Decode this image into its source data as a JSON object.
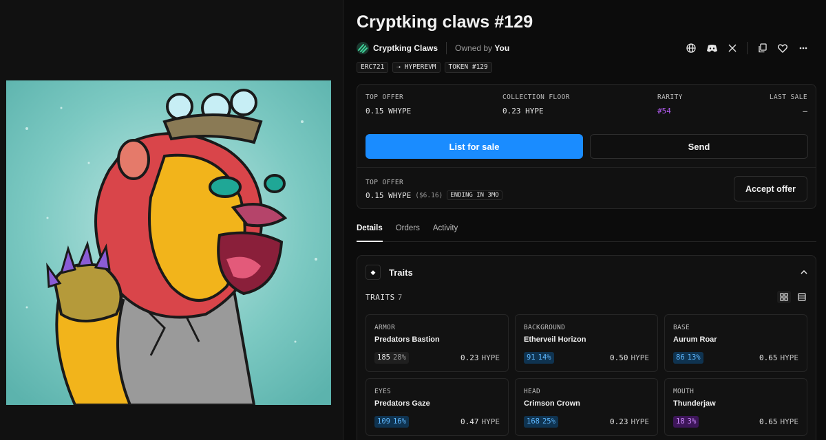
{
  "nft": {
    "title": "Cryptking claws #129",
    "collection_name": "Cryptking Claws",
    "owned_prefix": "Owned by",
    "owner": "You",
    "tags": [
      "ERC721",
      "⇢ HYPEREVM",
      "TOKEN #129"
    ]
  },
  "header_icons": [
    "globe-icon",
    "discord-icon",
    "x-icon",
    "copy-icon",
    "heart-icon",
    "more-icon"
  ],
  "stats": {
    "top_offer_label": "TOP OFFER",
    "top_offer_value": "0.15 WHYPE",
    "floor_label": "COLLECTION FLOOR",
    "floor_value": "0.23 HYPE",
    "rarity_label": "RARITY",
    "rarity_value": "#54",
    "last_sale_label": "LAST SALE",
    "last_sale_value": "–"
  },
  "buttons": {
    "list": "List for sale",
    "send": "Send",
    "accept": "Accept offer"
  },
  "offer": {
    "label": "TOP OFFER",
    "amount": "0.15 WHYPE",
    "usd": "($6.16)",
    "ending": "ENDING IN 3MO"
  },
  "tabs": [
    "Details",
    "Orders",
    "Activity"
  ],
  "traits": {
    "title": "Traits",
    "count_label": "TRAITS",
    "count": "7",
    "items": [
      {
        "category": "ARMOR",
        "name": "Predators Bastion",
        "count": "185",
        "pct": "28%",
        "price": "0.23",
        "unit": "HYPE",
        "tone": "gray"
      },
      {
        "category": "BACKGROUND",
        "name": "Etherveil Horizon",
        "count": "91",
        "pct": "14%",
        "price": "0.50",
        "unit": "HYPE",
        "tone": "blue"
      },
      {
        "category": "BASE",
        "name": "Aurum Roar",
        "count": "86",
        "pct": "13%",
        "price": "0.65",
        "unit": "HYPE",
        "tone": "blue"
      },
      {
        "category": "EYES",
        "name": "Predators Gaze",
        "count": "109",
        "pct": "16%",
        "price": "0.47",
        "unit": "HYPE",
        "tone": "blue"
      },
      {
        "category": "HEAD",
        "name": "Crimson Crown",
        "count": "168",
        "pct": "25%",
        "price": "0.23",
        "unit": "HYPE",
        "tone": "blue"
      },
      {
        "category": "MOUTH",
        "name": "Thunderjaw",
        "count": "18",
        "pct": "3%",
        "price": "0.65",
        "unit": "HYPE",
        "tone": "purple"
      }
    ]
  },
  "colors": {
    "accent": "#1a8cff",
    "rarity": "#b25cf0",
    "tone_gray_bg": "#1f1f1f",
    "tone_gray_fg": "#e6e6e6",
    "tone_blue_bg": "#0f3350",
    "tone_blue_fg": "#5fb8ff",
    "tone_purple_bg": "#3d1659",
    "tone_purple_fg": "#cf8cff"
  }
}
